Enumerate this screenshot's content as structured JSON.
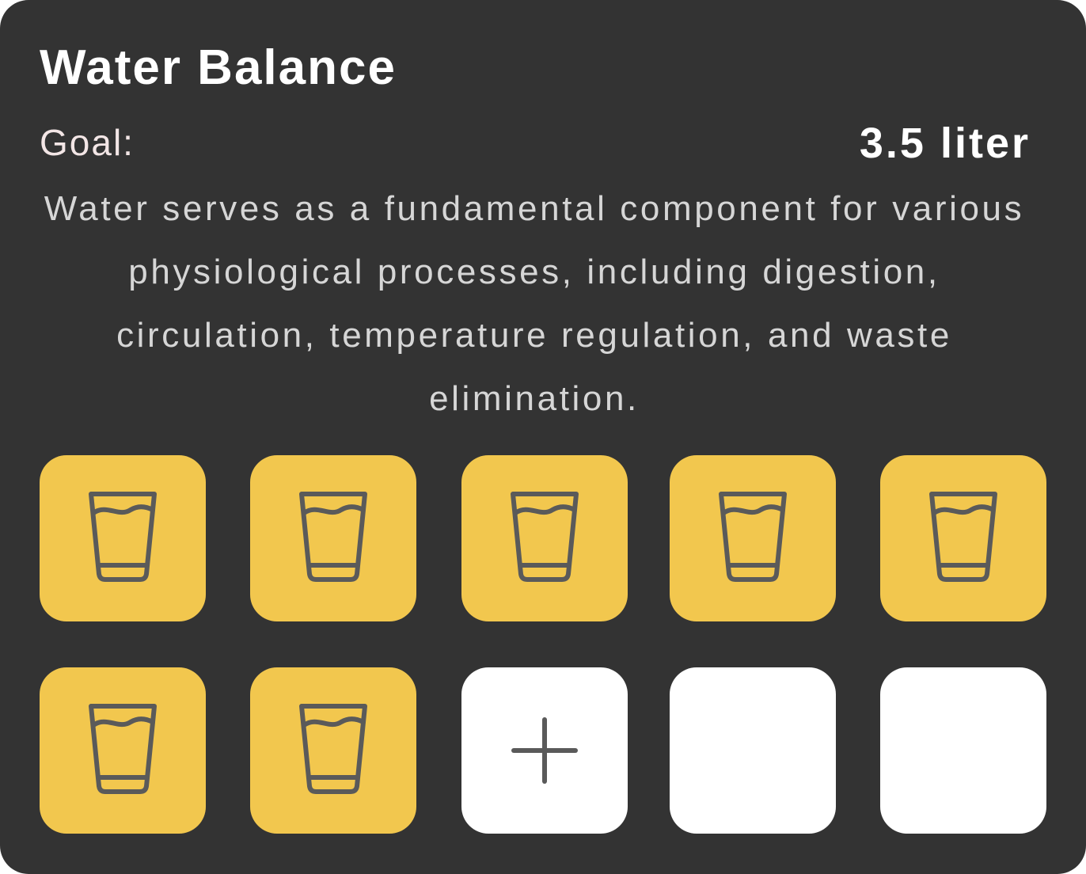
{
  "card": {
    "title": "Water Balance",
    "goal_label": "Goal:",
    "goal_value": "3.5 liter",
    "description": "Water serves as a fundamental component for various physiological processes, including digestion, circulation, temperature regulation, and waste elimination."
  },
  "glasses": {
    "total": 10,
    "filled": 7,
    "add_slot_index": 8,
    "filled_icon": "water-glass-icon",
    "add_icon": "plus-icon"
  },
  "colors": {
    "card_background": "#333333",
    "filled_tile": "#f2c74e",
    "empty_tile": "#ffffff",
    "icon_stroke": "#5a5a5a",
    "title_text": "#ffffff",
    "description_text": "#d6d6d6"
  }
}
